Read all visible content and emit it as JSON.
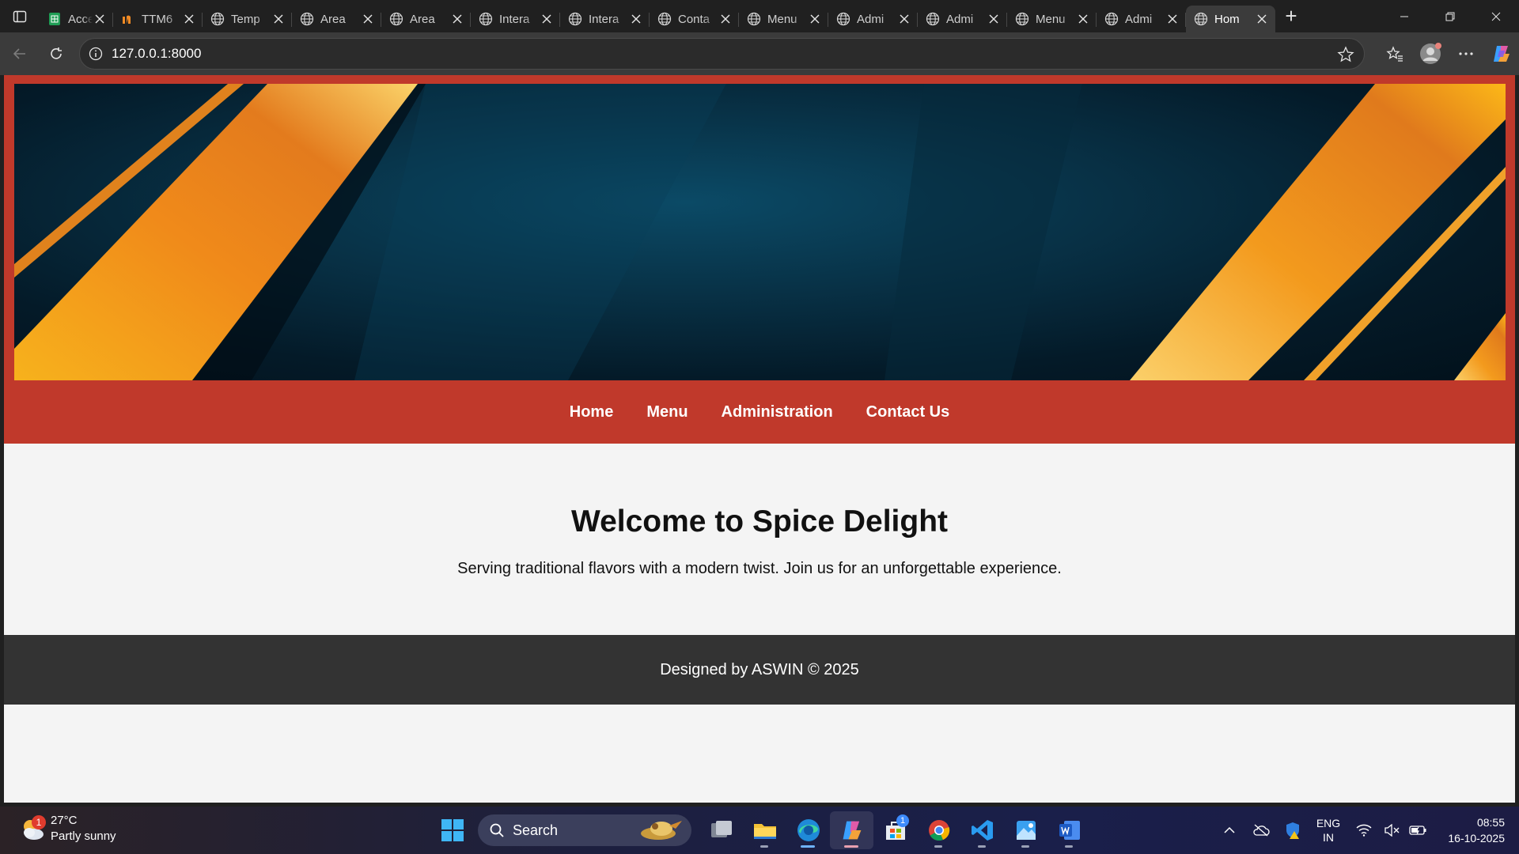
{
  "browser": {
    "tabs": [
      {
        "title": "Access",
        "icon": "sheets-icon"
      },
      {
        "title": "TTM6",
        "icon": "brand-icon"
      },
      {
        "title": "Temp",
        "icon": "globe-icon"
      },
      {
        "title": "Area",
        "icon": "globe-icon"
      },
      {
        "title": "Area",
        "icon": "globe-icon"
      },
      {
        "title": "Intera",
        "icon": "globe-icon"
      },
      {
        "title": "Intera",
        "icon": "globe-icon"
      },
      {
        "title": "Conta",
        "icon": "globe-icon"
      },
      {
        "title": "Menu",
        "icon": "globe-icon"
      },
      {
        "title": "Admi",
        "icon": "globe-icon"
      },
      {
        "title": "Admi",
        "icon": "globe-icon"
      },
      {
        "title": "Menu",
        "icon": "globe-icon"
      },
      {
        "title": "Admi",
        "icon": "globe-icon"
      },
      {
        "title": "Hom",
        "icon": "globe-icon",
        "active": true
      }
    ],
    "url": "127.0.0.1:8000"
  },
  "site": {
    "nav": [
      "Home",
      "Menu",
      "Administration",
      "Contact Us"
    ],
    "hero_title": "Welcome to Spice Delight",
    "hero_text": "Serving traditional flavors with a modern twist. Join us for an unforgettable experience.",
    "footer": "Designed by ASWIN © 2025",
    "colors": {
      "header": "#c0392b",
      "footer": "#333333",
      "page": "#f4f4f4"
    }
  },
  "taskbar": {
    "weather_badge": "1",
    "temperature": "27°C",
    "condition": "Partly sunny",
    "search_label": "Search",
    "store_badge": "1",
    "lang_1": "ENG",
    "lang_2": "IN",
    "time": "08:55",
    "date": "16-10-2025"
  }
}
